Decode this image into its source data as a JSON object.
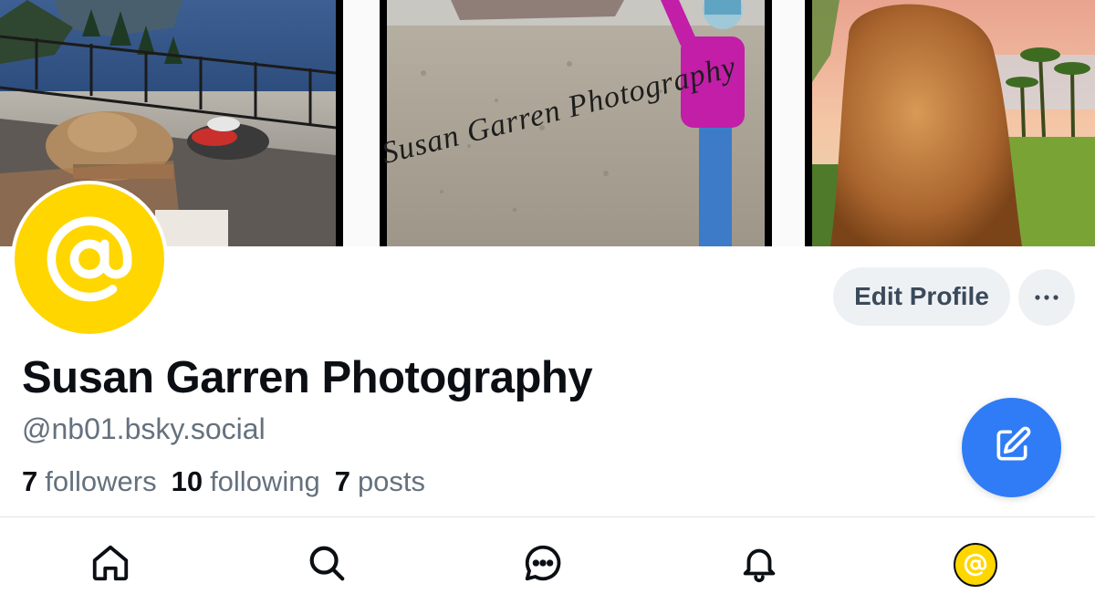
{
  "banner": {
    "watermark": "Susan Garren Photography"
  },
  "profile": {
    "avatar_symbol": "@",
    "display_name": "Susan Garren Photography",
    "handle": "@nb01.bsky.social",
    "stats": {
      "followers_count": "7",
      "followers_label": "followers",
      "following_count": "10",
      "following_label": "following",
      "posts_count": "7",
      "posts_label": "posts"
    }
  },
  "actions": {
    "edit_profile_label": "Edit Profile",
    "more_icon": "ellipsis-icon"
  },
  "fab": {
    "icon": "compose-icon"
  },
  "nav": {
    "items": [
      {
        "icon": "home-icon"
      },
      {
        "icon": "search-icon"
      },
      {
        "icon": "chat-icon"
      },
      {
        "icon": "bell-icon"
      },
      {
        "icon": "profile-avatar-icon",
        "symbol": "@"
      }
    ]
  },
  "colors": {
    "accent": "#2f7cf6",
    "avatar_bg": "#ffd600",
    "muted_text": "#65717e",
    "primary_text": "#0b0f14"
  }
}
